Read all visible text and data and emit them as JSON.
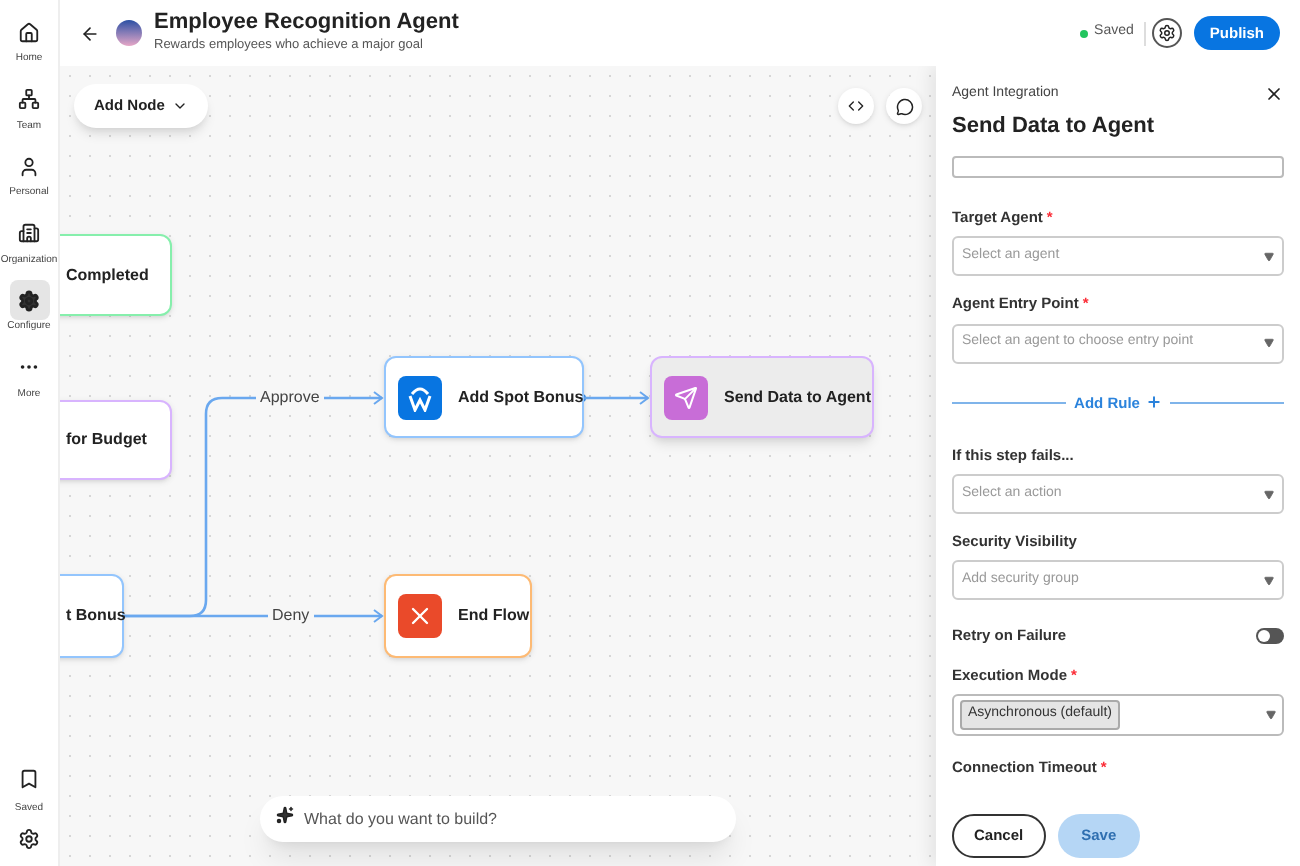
{
  "sidebar": {
    "items": [
      {
        "label": "Home",
        "selected": false
      },
      {
        "label": "Team",
        "selected": false
      },
      {
        "label": "Personal",
        "selected": false
      },
      {
        "label": "Organization",
        "selected": false
      },
      {
        "label": "Configure",
        "selected": true
      },
      {
        "label": "More",
        "selected": false
      }
    ],
    "saved": "Saved"
  },
  "header": {
    "title": "Employee Recognition Agent",
    "subtitle": "Rewards employees who achieve a major goal",
    "status": "Saved",
    "publish": "Publish"
  },
  "canvas": {
    "add_node": "Add Node",
    "prompt_placeholder": "What do you want to build?",
    "nodes": [
      {
        "label": "Completed",
        "kind": "plain",
        "color": "#86efac",
        "selected": false
      },
      {
        "label": "for Budget",
        "kind": "plain",
        "color": "#d8b4fe",
        "selected": false
      },
      {
        "label": "t Bonus",
        "kind": "plain",
        "color": "#93c5fd",
        "selected": false
      },
      {
        "label": "Add Spot Bonus",
        "kind": "workday",
        "color": "#93c5fd",
        "selected": false
      },
      {
        "label": "Send Data to Agent",
        "kind": "send",
        "color": "#d8b4fe",
        "selected": true
      },
      {
        "label": "End Flow",
        "kind": "end",
        "color": "#fdba74",
        "selected": false
      }
    ],
    "edges": [
      {
        "label": "Approve"
      },
      {
        "label": "Deny"
      }
    ]
  },
  "panel": {
    "category": "Agent Integration",
    "title": "Send Data to Agent",
    "fields": [
      {
        "kind": "select",
        "label": "Target Agent",
        "mark": "*",
        "placeholder": "Select an agent"
      },
      {
        "kind": "select",
        "label": "Agent Entry Point",
        "mark": "*",
        "placeholder": "Select an agent to choose entry point"
      },
      {
        "kind": "rule",
        "label": "Add Rule"
      },
      {
        "kind": "select",
        "label": "If this step fails...",
        "placeholder": "Select an action"
      },
      {
        "kind": "select",
        "label": "Security Visibility",
        "placeholder": "Add security group"
      },
      {
        "kind": "toggle",
        "label": "Retry on Failure",
        "on": false
      },
      {
        "kind": "chip",
        "label": "Execution Mode",
        "mark": "*",
        "value": "Asynchronous (default)"
      },
      {
        "kind": "heading",
        "label": "Connection Timeout",
        "mark": "*"
      }
    ],
    "cancel": "Cancel",
    "save": "Save",
    "save_disabled": true
  }
}
